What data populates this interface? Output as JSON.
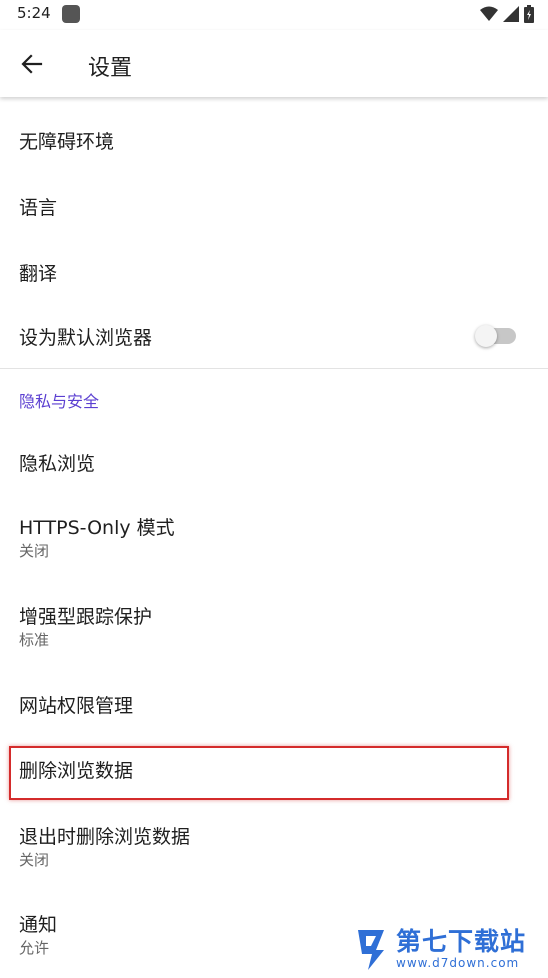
{
  "status_bar": {
    "time": "5:24",
    "icons": [
      "app-notification-icon",
      "wifi-icon",
      "signal-icon",
      "battery-icon"
    ]
  },
  "toolbar": {
    "back_icon": "arrow-left-icon",
    "title": "设置"
  },
  "settings": {
    "accessibility": "无障碍环境",
    "language": "语言",
    "translation": "翻译",
    "default_browser": {
      "label": "设为默认浏览器",
      "enabled": false
    },
    "privacy_section": "隐私与安全",
    "private_browsing": "隐私浏览",
    "https_only": {
      "label": "HTTPS-Only 模式",
      "value": "关闭"
    },
    "tracking_protection": {
      "label": "增强型跟踪保护",
      "value": "标准"
    },
    "site_permissions": "网站权限管理",
    "delete_browsing_data": "删除浏览数据",
    "delete_on_quit": {
      "label": "退出时删除浏览数据",
      "value": "关闭"
    },
    "notifications": {
      "label": "通知",
      "value": "允许"
    }
  },
  "watermark": {
    "name": "第七下载站",
    "url": "www.d7down.com"
  },
  "colors": {
    "accent": "#5b3fd1",
    "highlight": "#d42b2b",
    "watermark": "#2f6fd6"
  }
}
